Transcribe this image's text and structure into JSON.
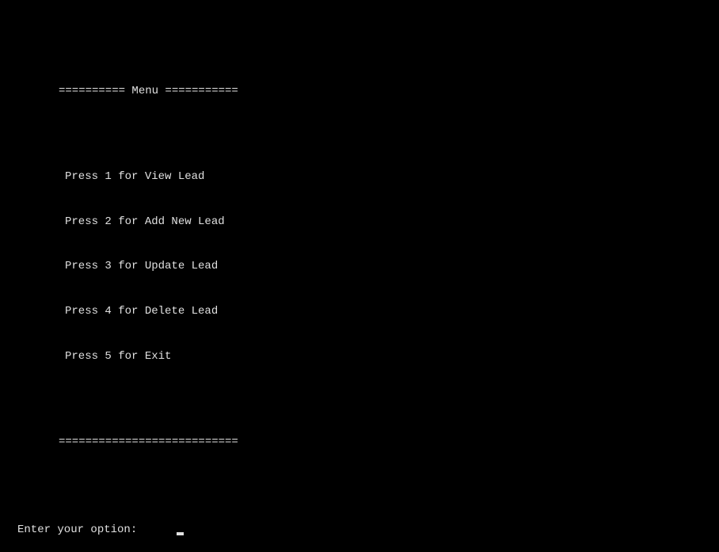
{
  "menu": {
    "header": "========== Menu ===========",
    "items": [
      "Press 1 for View Lead",
      "Press 2 for Add New Lead",
      "Press 3 for Update Lead",
      "Press 4 for Delete Lead",
      "Press 5 for Exit"
    ],
    "footer": "==========================="
  },
  "prompt": {
    "label": "Enter your option:"
  }
}
